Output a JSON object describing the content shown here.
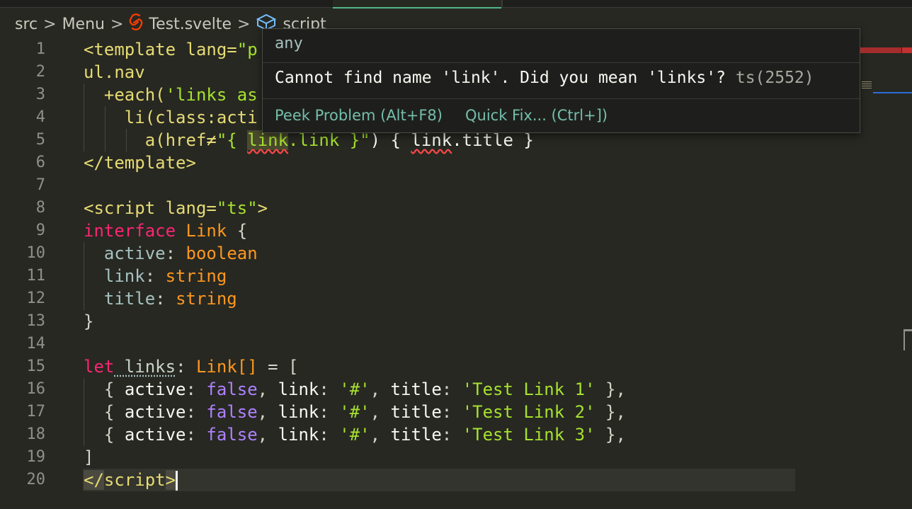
{
  "breadcrumb": {
    "items": [
      "src",
      "Menu",
      "Test.svelte",
      "script"
    ],
    "separator": ">"
  },
  "editor": {
    "line_numbers": [
      "1",
      "2",
      "3",
      "4",
      "5",
      "6",
      "7",
      "8",
      "9",
      "10",
      "11",
      "12",
      "13",
      "14",
      "15",
      "16",
      "17",
      "18",
      "19",
      "20"
    ],
    "lines": {
      "l1_a": "<template",
      "l1_b": " lang=",
      "l1_c": "\"p",
      "l2": "ul.nav",
      "l3_a": "+each(",
      "l3_b": "'links as",
      "l4_a": "li(",
      "l4_b": "class:acti",
      "l5_a": "a(",
      "l5_b": "href≠",
      "l5_c": "\"{ ",
      "l5_d": "link",
      "l5_e": ".link }\"",
      "l5_f": ") { ",
      "l5_g": "link",
      "l5_h": ".title }",
      "l6": "</template>",
      "l8_a": "<script",
      "l8_b": " lang=",
      "l8_c": "\"ts\"",
      "l8_d": ">",
      "l9_a": "interface",
      "l9_b": " Link",
      "l9_c": " {",
      "l10_a": "active",
      "l10_b": ": ",
      "l10_c": "boolean",
      "l11_a": "link",
      "l11_b": ": ",
      "l11_c": "string",
      "l12_a": "title",
      "l12_b": ": ",
      "l12_c": "string",
      "l13": "}",
      "l15_a": "let",
      "l15_b": " links",
      "l15_c": ": ",
      "l15_d": "Link[]",
      "l15_e": " = [",
      "l16_a": "{ ",
      "l16_b": "active",
      "l16_c": ": ",
      "l16_d": "false",
      "l16_e": ", ",
      "l16_f": "link",
      "l16_g": ": ",
      "l16_h": "'#'",
      "l16_i": ", ",
      "l16_j": "title",
      "l16_k": ": ",
      "l16_l": "'Test Link 1'",
      "l16_m": " },",
      "l17_l": "'Test Link 2'",
      "l18_l": "'Test Link 3'",
      "l19": "]",
      "l20_a": "</",
      "l20_b": "script",
      "l20_c": ">"
    }
  },
  "hover": {
    "type": "any",
    "message": "Cannot find name 'link'. Did you mean 'links'?",
    "code": "ts(2552)",
    "actions": [
      "Peek Problem (Alt+F8)",
      "Quick Fix... (Ctrl+])"
    ]
  },
  "colors": {
    "background": "#272822",
    "error": "#f44747",
    "link_action": "#75beac",
    "svelte": "#ff3e00"
  },
  "icons": [
    "chevron-right-icon",
    "svelte-icon",
    "cube-icon"
  ]
}
